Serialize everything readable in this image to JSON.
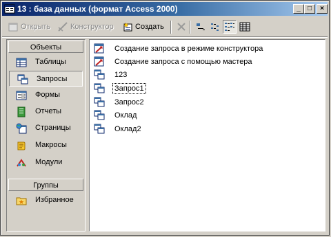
{
  "window": {
    "title": "13 : база данных (формат Access 2000)"
  },
  "titlebar_buttons": {
    "minimize": "_",
    "maximize": "□",
    "close": "×"
  },
  "toolbar": {
    "open_label": "Открыть",
    "design_label": "Конструктор",
    "create_label": "Создать"
  },
  "sidebar": {
    "objects_header": "Объекты",
    "groups_header": "Группы",
    "items": [
      {
        "label": "Таблицы",
        "icon": "table-icon"
      },
      {
        "label": "Запросы",
        "icon": "query-icon",
        "selected": true
      },
      {
        "label": "Формы",
        "icon": "form-icon"
      },
      {
        "label": "Отчеты",
        "icon": "report-icon"
      },
      {
        "label": "Страницы",
        "icon": "page-icon"
      },
      {
        "label": "Макросы",
        "icon": "macro-icon"
      },
      {
        "label": "Модули",
        "icon": "module-icon"
      }
    ],
    "groups": [
      {
        "label": "Избранное",
        "icon": "favorites-folder-icon"
      }
    ]
  },
  "list": {
    "items": [
      {
        "label": "Создание запроса в режиме конструктора",
        "icon": "wizard-icon"
      },
      {
        "label": "Создание запроса с помощью мастера",
        "icon": "wizard-icon"
      },
      {
        "label": "123",
        "icon": "query-icon"
      },
      {
        "label": "Запрос1",
        "icon": "query-icon",
        "focused": true
      },
      {
        "label": "Запрос2",
        "icon": "query-icon"
      },
      {
        "label": "Оклад",
        "icon": "query-icon"
      },
      {
        "label": "Оклад2",
        "icon": "query-icon"
      }
    ]
  },
  "colors": {
    "titlebar_start": "#0a246a",
    "titlebar_end": "#a6caf0",
    "face": "#d4d0c8"
  }
}
